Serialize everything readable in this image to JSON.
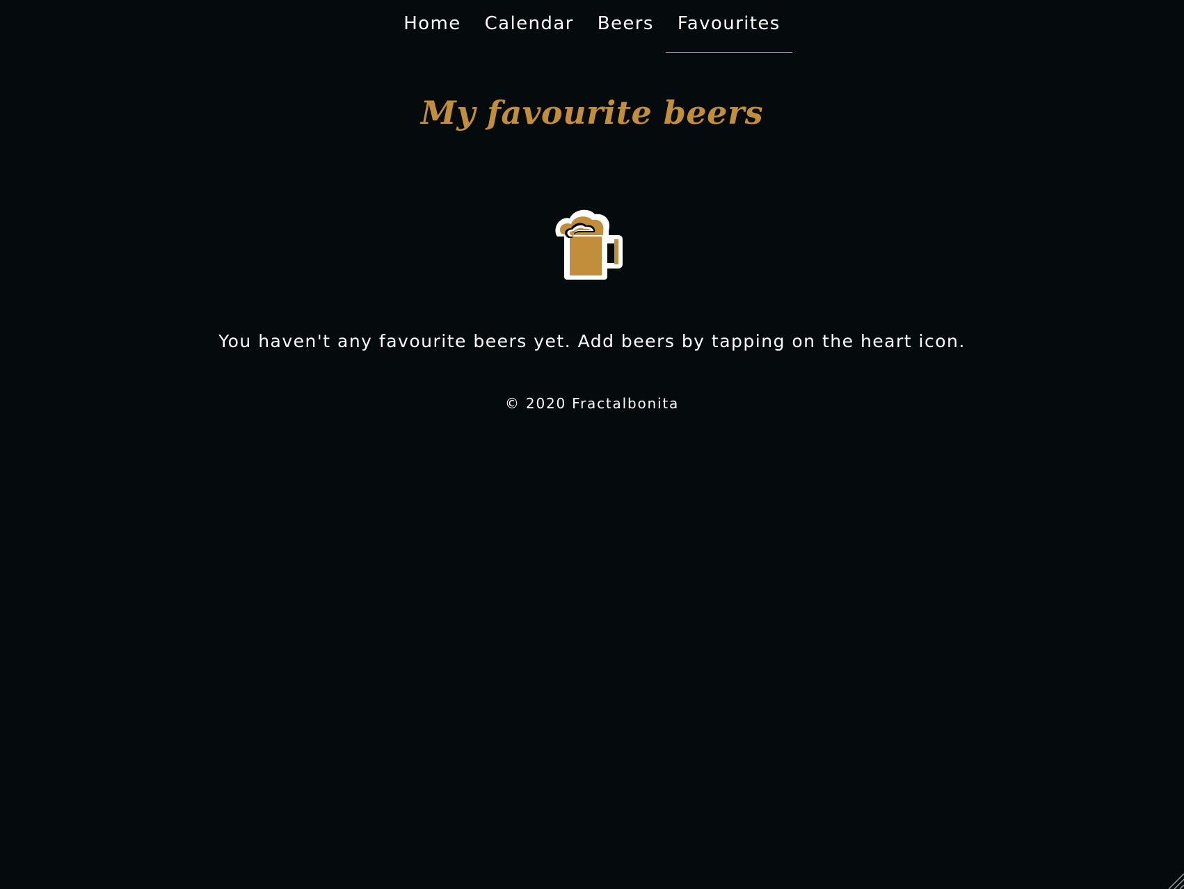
{
  "nav": {
    "items": [
      {
        "label": "Home"
      },
      {
        "label": "Calendar"
      },
      {
        "label": "Beers"
      },
      {
        "label": "Favourites"
      }
    ],
    "active": "Favourites"
  },
  "main": {
    "title": "My favourite beers",
    "icon": "beer-mug-icon",
    "empty_message": "You haven't any favourite beers yet. Add beers by tapping on the heart icon."
  },
  "footer": {
    "copyright": "© 2020 Fractalbonita"
  },
  "colors": {
    "background": "#050b0c",
    "accent": "#c28e3c",
    "text": "#ffffff"
  }
}
